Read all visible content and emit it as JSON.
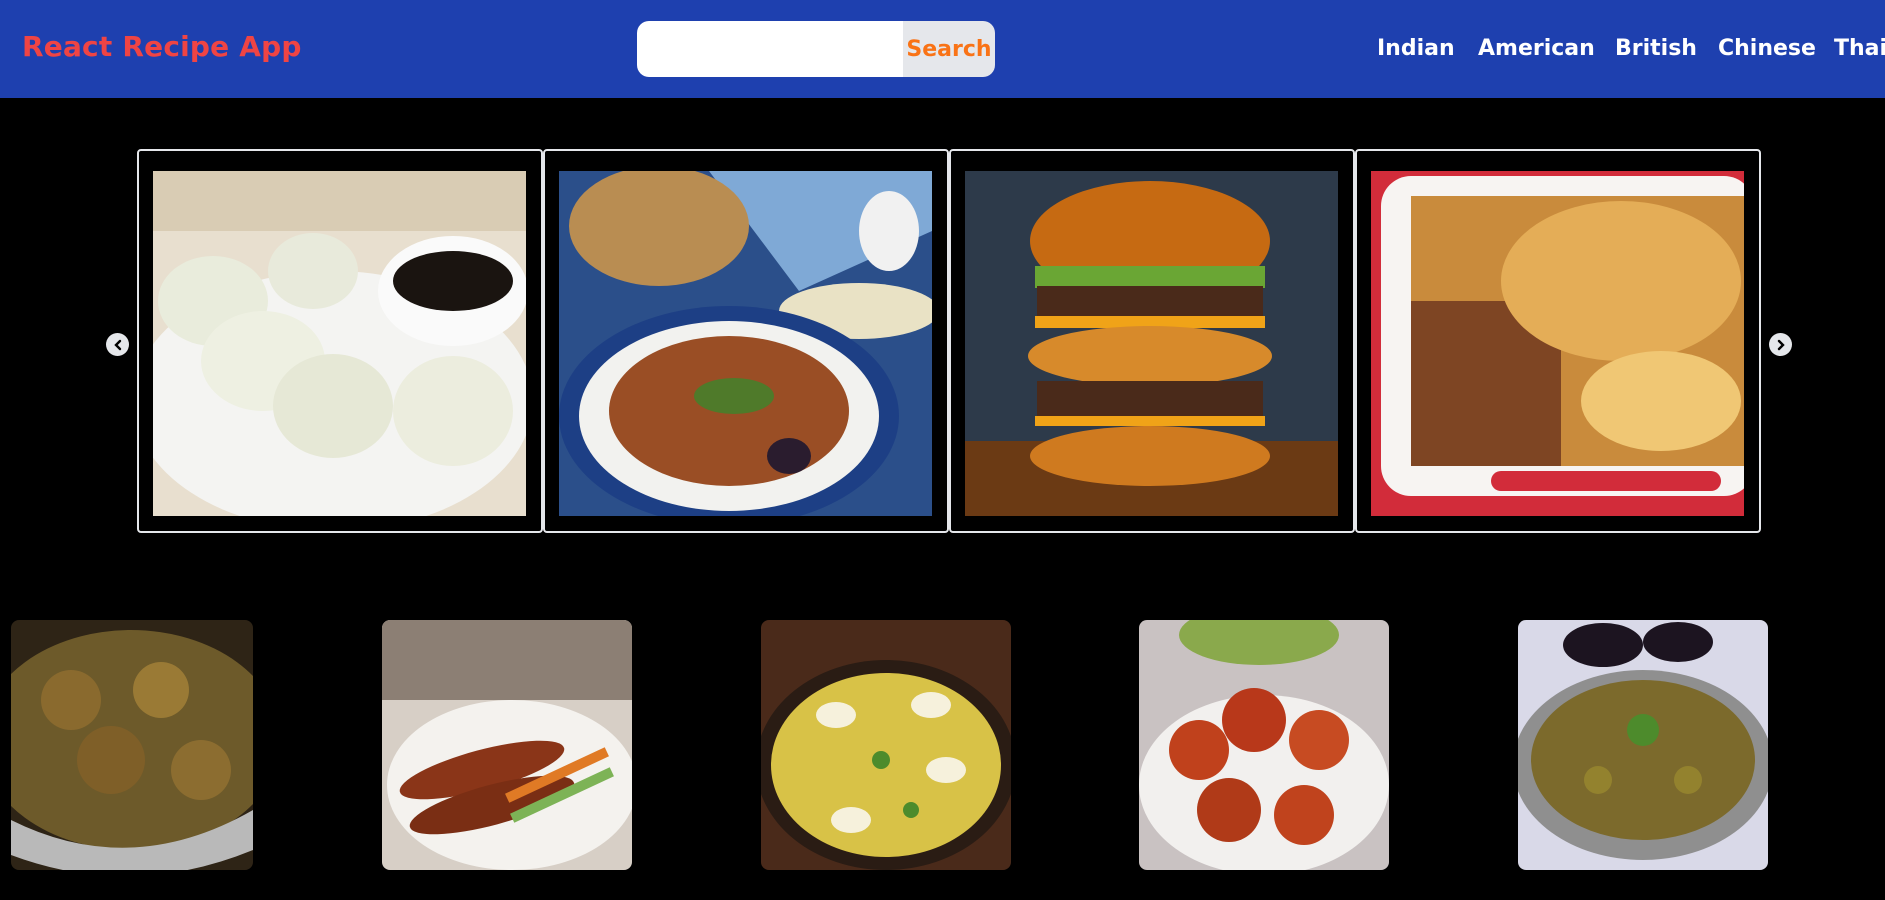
{
  "app": {
    "title": "React Recipe App"
  },
  "search": {
    "placeholder": "",
    "value": "",
    "button_label": "Search"
  },
  "nav": {
    "cuisines": [
      "Indian",
      "American",
      "British",
      "Chinese",
      "Thai"
    ]
  },
  "carousel": {
    "prev_icon": "chevron-left-circle-icon",
    "next_icon": "chevron-right-circle-icon",
    "slides": [
      {
        "name": "dumplings"
      },
      {
        "name": "vegetable-platter"
      },
      {
        "name": "double-burger"
      },
      {
        "name": "lasagna"
      }
    ]
  },
  "grid": {
    "items": [
      {
        "name": "curry-dish"
      },
      {
        "name": "fried-fish"
      },
      {
        "name": "kedgeree"
      },
      {
        "name": "tandoori-chicken"
      },
      {
        "name": "baingan-bharta"
      }
    ]
  },
  "colors": {
    "navbar": "#1e40af",
    "brand": "#ef4444",
    "search_button_text": "#f97316",
    "background": "#000000"
  }
}
